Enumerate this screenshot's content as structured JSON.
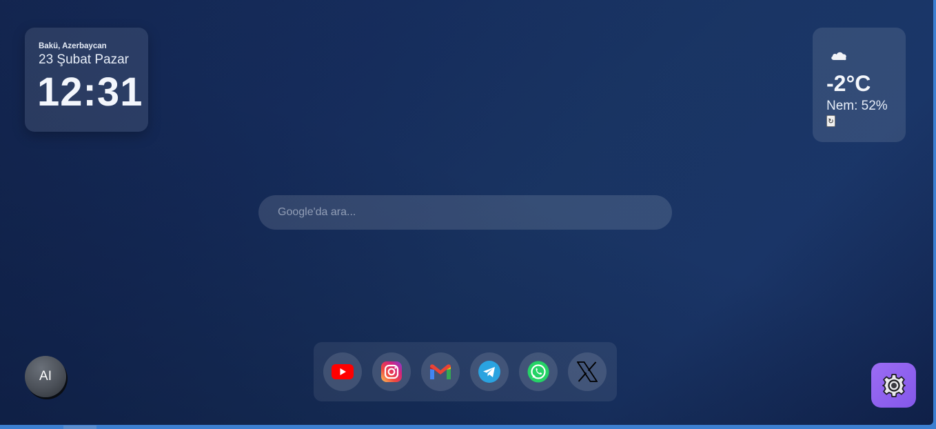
{
  "clock": {
    "location": "Bakü, Azerbaycan",
    "date": "23 Şubat Pazar",
    "time": "12:31"
  },
  "weather": {
    "icon": "cloud-icon",
    "temperature": "-2°C",
    "humidity": "Nem: 52%",
    "refresh_label": "↻"
  },
  "search": {
    "placeholder": "Google'da ara..."
  },
  "dock": {
    "apps": [
      {
        "name": "YouTube",
        "icon": "youtube-icon",
        "color": "#ff0000"
      },
      {
        "name": "Instagram",
        "icon": "instagram-icon",
        "color": "#e1306c"
      },
      {
        "name": "Gmail",
        "icon": "gmail-icon",
        "color": "#ea4335"
      },
      {
        "name": "Telegram",
        "icon": "telegram-icon",
        "color": "#2aa3e0"
      },
      {
        "name": "WhatsApp",
        "icon": "whatsapp-icon",
        "color": "#25d366"
      },
      {
        "name": "X",
        "icon": "x-icon",
        "color": "#000000"
      }
    ]
  },
  "ai_button": {
    "label": "AI"
  },
  "settings": {
    "icon": "gear-icon",
    "color": "#8f62ee"
  },
  "theme": {
    "background": "#152b5a",
    "card": "rgba(255,255,255,0.10)"
  }
}
